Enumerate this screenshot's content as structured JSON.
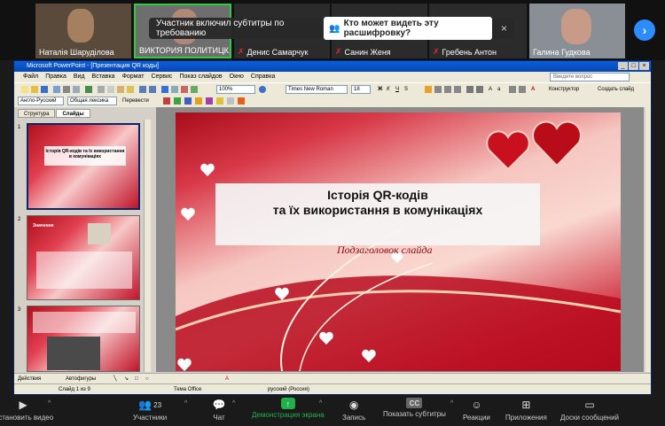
{
  "participants": [
    {
      "name": "Наталія Шаруділова",
      "muted": false
    },
    {
      "name": "ВИКТОРИЯ ПОЛИТИЦК...",
      "muted": false
    },
    {
      "name": "Денис Самарчук",
      "muted": true
    },
    {
      "name": "Санин Женя",
      "muted": true
    },
    {
      "name": "Гребень Антон",
      "muted": true
    },
    {
      "name": "Галина Гудкова",
      "muted": false
    }
  ],
  "caption_banner": {
    "text": "Участник включил субтитры по требованию",
    "link": "Кто может видеть эту расшифровку?",
    "close": "×"
  },
  "ppt": {
    "window_title": "Microsoft PowerPoint - [Презентация QR коды]",
    "menu": [
      "Файл",
      "Правка",
      "Вид",
      "Вставка",
      "Формат",
      "Сервис",
      "Показ слайдов",
      "Окно",
      "Справка"
    ],
    "help_placeholder": "Введите вопрос",
    "zoom": "100%",
    "font": "Times New Roman",
    "font_size": "18",
    "constructor_label": "Конструктор",
    "new_slide_label": "Создать слайд",
    "translator_lang": "Англо-Русский",
    "translator_dict": "Общая лексика",
    "translate_label": "Перевести",
    "tabs": [
      "Структура",
      "Слайды"
    ],
    "thumbs": [
      {
        "num": "1",
        "text": "Історія QR-кодів та їх використання в комунікаціях"
      },
      {
        "num": "2",
        "text": "Значення"
      },
      {
        "num": "3",
        "text": ""
      }
    ],
    "slide": {
      "title_line1": "Історія QR-кодів",
      "title_line2": "та їх використання в комунікаціях",
      "subtitle": "Подзаголовок слайда"
    },
    "drawbar": {
      "actions": "Действия",
      "autoshapes": "Автофигуры"
    },
    "status": {
      "slide": "Слайд 1 из 9",
      "theme": "Тема Office",
      "lang": "русский (Россия)"
    }
  },
  "toolbar": [
    {
      "label": "Остановить видео",
      "icon": "video-camera-icon"
    },
    {
      "label": "Участники",
      "icon": "participants-icon",
      "count": "23"
    },
    {
      "label": "Чат",
      "icon": "chat-icon"
    },
    {
      "label": "Демонстрация экрана",
      "icon": "share-screen-icon"
    },
    {
      "label": "Запись",
      "icon": "record-icon"
    },
    {
      "label": "Показать субтитры",
      "icon": "cc-icon"
    },
    {
      "label": "Реакции",
      "icon": "reaction-icon"
    },
    {
      "label": "Приложения",
      "icon": "apps-icon"
    },
    {
      "label": "Доски сообщений",
      "icon": "whiteboard-icon"
    }
  ],
  "colors": {
    "zoom_green": "#21b14b",
    "zoom_blue": "#2d8cff",
    "slide_red": "#b0101a"
  }
}
